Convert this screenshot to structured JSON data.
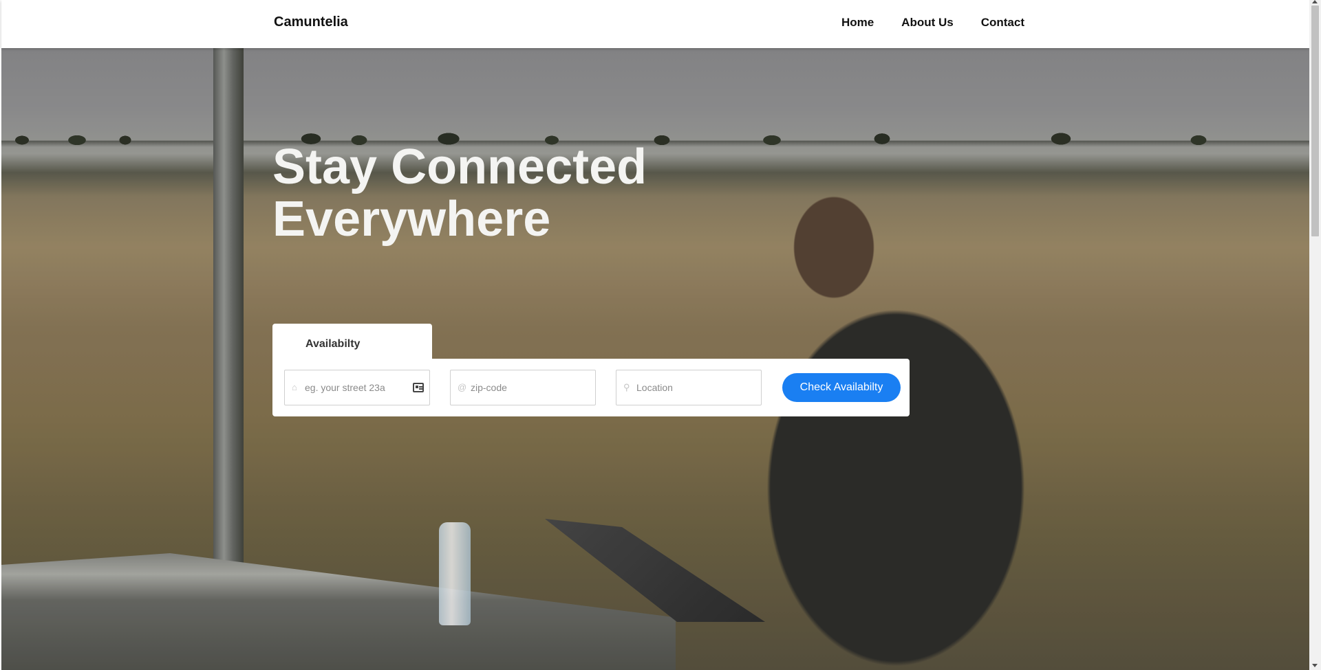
{
  "header": {
    "brand": "Camuntelia",
    "nav": [
      {
        "label": "Home"
      },
      {
        "label": "About Us"
      },
      {
        "label": "Contact"
      }
    ]
  },
  "hero": {
    "title_line1": "Stay Connected",
    "title_line2": "Everywhere"
  },
  "availability": {
    "tab_label": "Availabilty",
    "street_placeholder": "eg. your street 23a",
    "zip_placeholder": "zip-code",
    "location_placeholder": "Location",
    "button_label": "Check Availabilty"
  },
  "icons": {
    "street": "home-icon",
    "street_trailing": "address-card-icon",
    "zip": "at-sign-icon",
    "location": "map-pin-icon"
  },
  "colors": {
    "accent": "#1a7ff2"
  }
}
